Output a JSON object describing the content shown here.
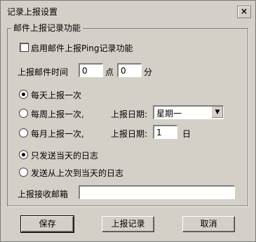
{
  "window": {
    "title": "记录上报设置",
    "close_glyph": "×"
  },
  "group": {
    "label": "邮件上报记录功能"
  },
  "enable_ping": {
    "label": "启用邮件上报Ping记录功能",
    "checked": false
  },
  "time": {
    "label": "上报邮件时间",
    "hour": "0",
    "hour_unit": "点",
    "minute": "0",
    "minute_unit": "分"
  },
  "schedule": {
    "daily": {
      "label": "每天上报一次",
      "selected": true
    },
    "weekly": {
      "label": "每周上报一次,",
      "date_label": "上报日期:",
      "value": "星期一",
      "selected": false
    },
    "monthly": {
      "label": "每月上报一次,",
      "date_label": "上报日期:",
      "value": "1",
      "unit": "日",
      "selected": false
    }
  },
  "log_range": {
    "today_only": {
      "label": "只发送当天的日志",
      "selected": true
    },
    "since_last": {
      "label": "发送从上次到当天的日志",
      "selected": false
    }
  },
  "recipient": {
    "label": "上报接收邮箱",
    "value": ""
  },
  "buttons": {
    "save": "保存",
    "report": "上报记录",
    "cancel": "取消"
  },
  "icons": {
    "dropdown": "chevron-down-icon"
  }
}
